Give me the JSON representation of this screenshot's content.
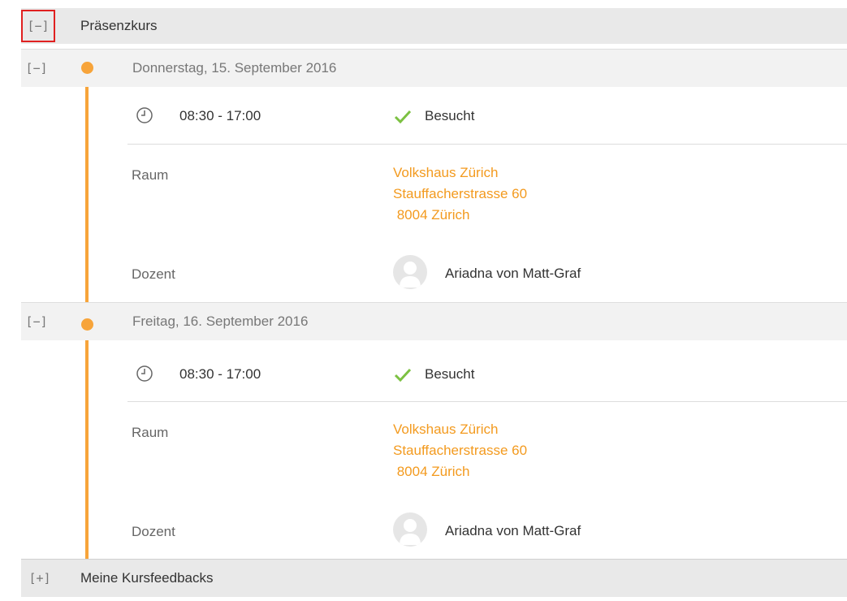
{
  "section_presence": {
    "toggle_symbol": "[−]",
    "title": "Präsenzkurs"
  },
  "days": [
    {
      "toggle_symbol": "[−]",
      "date": "Donnerstag, 15. September 2016",
      "time": "08:30 - 17:00",
      "status": "Besucht",
      "room_label": "Raum",
      "room_lines": [
        "Volkshaus Zürich",
        "Stauffacherstrasse 60",
        " 8004 Zürich"
      ],
      "teacher_label": "Dozent",
      "teacher_name": "Ariadna von Matt-Graf"
    },
    {
      "toggle_symbol": "[−]",
      "date": "Freitag, 16. September 2016",
      "time": "08:30 - 17:00",
      "status": "Besucht",
      "room_label": "Raum",
      "room_lines": [
        "Volkshaus Zürich",
        "Stauffacherstrasse 60",
        " 8004 Zürich"
      ],
      "teacher_label": "Dozent",
      "teacher_name": "Ariadna von Matt-Graf"
    }
  ],
  "section_feedback": {
    "toggle_symbol": "[+]",
    "title": "Meine Kursfeedbacks"
  },
  "colors": {
    "accent": "#f7a43a",
    "link": "#f39a1e",
    "check": "#7cc142",
    "highlight": "#e02020"
  }
}
